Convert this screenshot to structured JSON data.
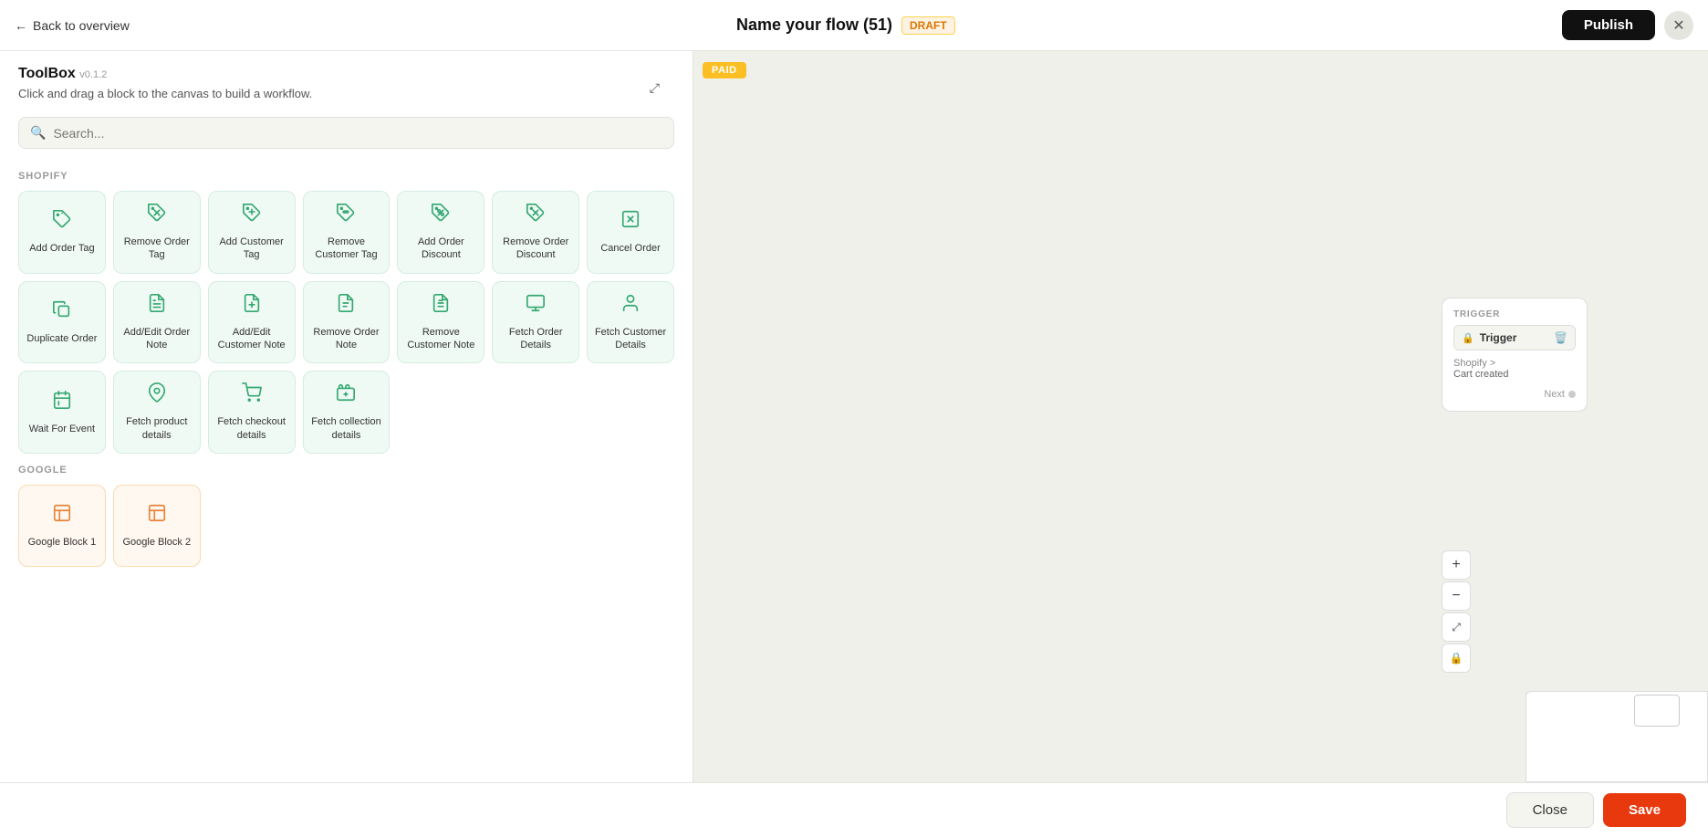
{
  "header": {
    "back_label": "Back to overview",
    "flow_title": "Name your flow (51)",
    "draft_badge": "DRAFT",
    "publish_label": "Publish",
    "close_icon": "✕"
  },
  "toolbox": {
    "title": "ToolBox",
    "version": "v0.1.2",
    "description": "Click and drag a block to the canvas to build a workflow.",
    "search_placeholder": "Search...",
    "collapse_icon": "⤢"
  },
  "sections": [
    {
      "name": "SHOPIFY",
      "blocks": [
        {
          "icon": "🏷️",
          "label": "Add Order Tag"
        },
        {
          "icon": "🏷️",
          "label": "Remove Order Tag"
        },
        {
          "icon": "🏷️",
          "label": "Add Customer Tag"
        },
        {
          "icon": "🏷️",
          "label": "Remove Customer Tag"
        },
        {
          "icon": "🏷️",
          "label": "Add Order Discount"
        },
        {
          "icon": "🏷️",
          "label": "Remove Order Discount"
        },
        {
          "icon": "📦",
          "label": "Cancel Order"
        },
        {
          "icon": "📋",
          "label": "Duplicate Order"
        },
        {
          "icon": "📝",
          "label": "Add/Edit Order Note"
        },
        {
          "icon": "📝",
          "label": "Add/Edit Customer Note"
        },
        {
          "icon": "📝",
          "label": "Remove Order Note"
        },
        {
          "icon": "📝",
          "label": "Remove Customer Note"
        },
        {
          "icon": "📦",
          "label": "Fetch Order Details"
        },
        {
          "icon": "👤",
          "label": "Fetch Customer Details"
        },
        {
          "icon": "📋",
          "label": "Wait For Event"
        },
        {
          "icon": "📦",
          "label": "Fetch product details"
        },
        {
          "icon": "🛒",
          "label": "Fetch checkout details"
        },
        {
          "icon": "📋",
          "label": "Fetch collection details"
        }
      ]
    },
    {
      "name": "GOOGLE",
      "blocks": [
        {
          "icon": "📊",
          "label": "Google Block 1"
        },
        {
          "icon": "📊",
          "label": "Google Block 2"
        }
      ]
    }
  ],
  "canvas": {
    "paid_badge": "PAID",
    "trigger_label": "TRIGGER",
    "trigger_name": "Trigger",
    "trigger_source": "Shopify >",
    "trigger_event": "Cart created",
    "trigger_next": "Next"
  },
  "footer": {
    "close_label": "Close",
    "save_label": "Save"
  }
}
